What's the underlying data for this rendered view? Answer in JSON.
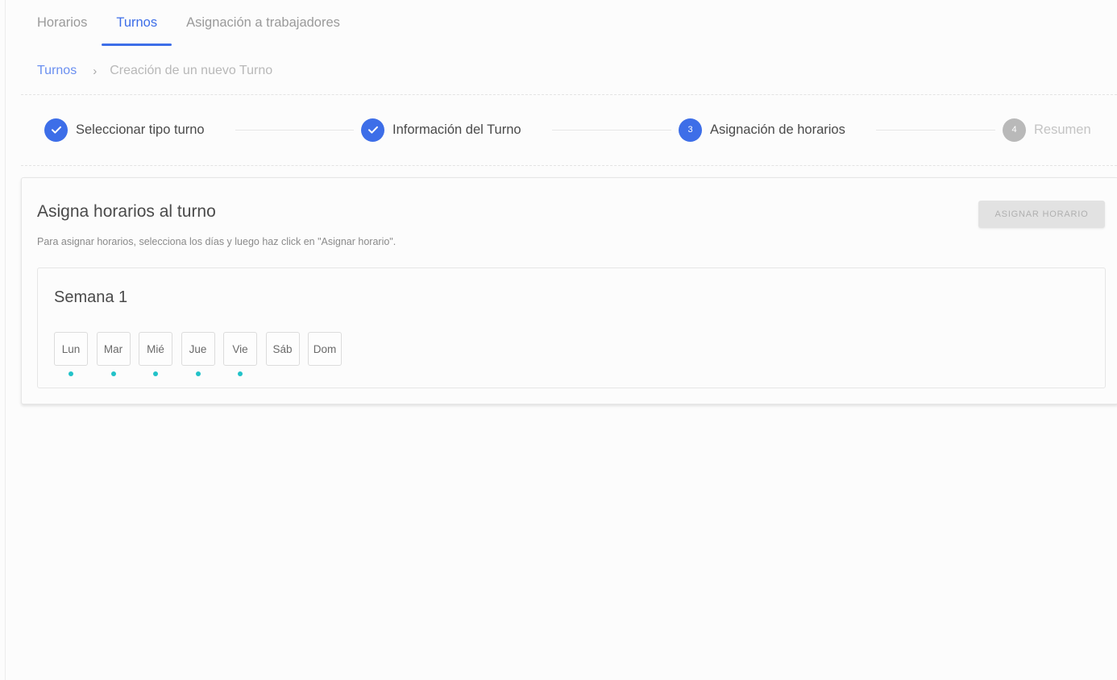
{
  "tabs": [
    {
      "label": "Horarios",
      "active": false
    },
    {
      "label": "Turnos",
      "active": true
    },
    {
      "label": "Asignación a trabajadores",
      "active": false
    }
  ],
  "breadcrumb": {
    "root": "Turnos",
    "current": "Creación de un nuevo Turno"
  },
  "stepper": {
    "steps": [
      {
        "number": "1",
        "label": "Seleccionar tipo turno",
        "state": "done"
      },
      {
        "number": "2",
        "label": "Información del Turno",
        "state": "done"
      },
      {
        "number": "3",
        "label": "Asignación de horarios",
        "state": "current"
      },
      {
        "number": "4",
        "label": "Resumen",
        "state": "pending"
      }
    ]
  },
  "card": {
    "title": "Asigna horarios al turno",
    "subtitle": "Para asignar horarios, selecciona los días y luego haz click en \"Asignar horario\".",
    "assign_button_label": "ASIGNAR HORARIO",
    "assign_button_disabled": true
  },
  "week": {
    "title": "Semana 1",
    "days": [
      {
        "label": "Lun",
        "has_schedule": true
      },
      {
        "label": "Mar",
        "has_schedule": true
      },
      {
        "label": "Mié",
        "has_schedule": true
      },
      {
        "label": "Jue",
        "has_schedule": true
      },
      {
        "label": "Vie",
        "has_schedule": true
      },
      {
        "label": "Sáb",
        "has_schedule": false
      },
      {
        "label": "Dom",
        "has_schedule": false
      }
    ]
  },
  "colors": {
    "accent": "#3d6ee8",
    "pending_step": "#b9b9b9",
    "schedule_dot": "#22c2c8",
    "disabled_button": "#e2e2e2"
  }
}
